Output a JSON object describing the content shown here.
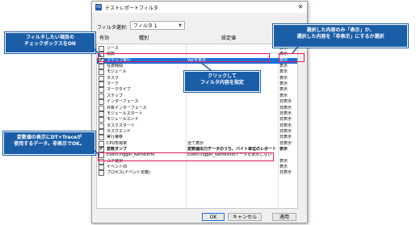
{
  "dialog": {
    "title": "テストレポートフィルタ",
    "app_icon": "PD",
    "close": "✕"
  },
  "filter": {
    "label": "フィルタ選択:",
    "value": "フィルタ 1"
  },
  "columns": {
    "enabled": "有効",
    "kind": "種別",
    "setting": "設定値",
    "display": ""
  },
  "rows": [
    {
      "checked": false,
      "kind": "ソース",
      "setting": "",
      "display": "表示"
    },
    {
      "checked": false,
      "kind": "関数",
      "setting": "",
      "display": "表示"
    },
    {
      "checked": true,
      "kind": "ステップ実行",
      "setting": "Varを表示",
      "display": "表示",
      "selected": true
    },
    {
      "checked": false,
      "kind": "任意時間",
      "setting": "",
      "display": "表示"
    },
    {
      "checked": false,
      "kind": "モジュール",
      "setting": "",
      "display": "表示"
    },
    {
      "checked": false,
      "kind": "タスク",
      "setting": "",
      "display": "表示"
    },
    {
      "checked": false,
      "kind": "マーク",
      "setting": "",
      "display": "表示"
    },
    {
      "checked": false,
      "kind": "マークタイプ",
      "setting": "全て表示",
      "display": "表示"
    },
    {
      "checked": false,
      "kind": "ステップ",
      "setting": "",
      "display": "表示"
    },
    {
      "checked": false,
      "kind": "インターフェース",
      "setting": "",
      "display": "非表示"
    },
    {
      "checked": false,
      "kind": "共有インターフェース",
      "setting": "",
      "display": "非表示"
    },
    {
      "checked": false,
      "kind": "モジュールスタート",
      "setting": "",
      "display": "非表示"
    },
    {
      "checked": false,
      "kind": "モジュールエンド",
      "setting": "",
      "display": "非表示"
    },
    {
      "checked": false,
      "kind": "タスクスタート",
      "setting": "",
      "display": "非表示"
    },
    {
      "checked": false,
      "kind": "タスクエンド",
      "setting": "",
      "display": "非表示"
    },
    {
      "checked": false,
      "kind": "実行遷移",
      "setting": "",
      "display": "非表示"
    },
    {
      "checked": false,
      "kind": "CPU負荷率",
      "setting": "全て表示",
      "display": "非表示"
    },
    {
      "checked": true,
      "kind": "変数ダンプ",
      "setting": "変数値出力データのうち、バイト単位のレポートを",
      "display": "表示",
      "bold": true
    },
    {
      "checked": false,
      "kind": "EventTrigger_KernelInfo",
      "setting": "EventTrigger_KernelInfoデータを表示しない",
      "display": ""
    },
    {
      "checked": false,
      "kind": "コア選択",
      "setting": "",
      "display": "表示"
    },
    {
      "checked": false,
      "kind": "イベントID",
      "setting": "",
      "display": "表示"
    },
    {
      "checked": false,
      "kind": "プロセス(イベント定義)",
      "setting": "",
      "display": "非表示"
    }
  ],
  "buttons": {
    "ok": "OK",
    "cancel": "キャンセル",
    "apply": "適用"
  },
  "callouts": {
    "check": [
      "フィルタしたい項目の",
      "チェックボックスをON"
    ],
    "click": [
      "クリックして",
      "フィルタ内容を指定"
    ],
    "display": [
      "選択した内容のみ「表示」か、",
      "選択した内容を「非表示」にするか選択"
    ],
    "variable": [
      "変数値の表示にDT+Traceが",
      "使用するデータ。非表示でOK。"
    ]
  }
}
